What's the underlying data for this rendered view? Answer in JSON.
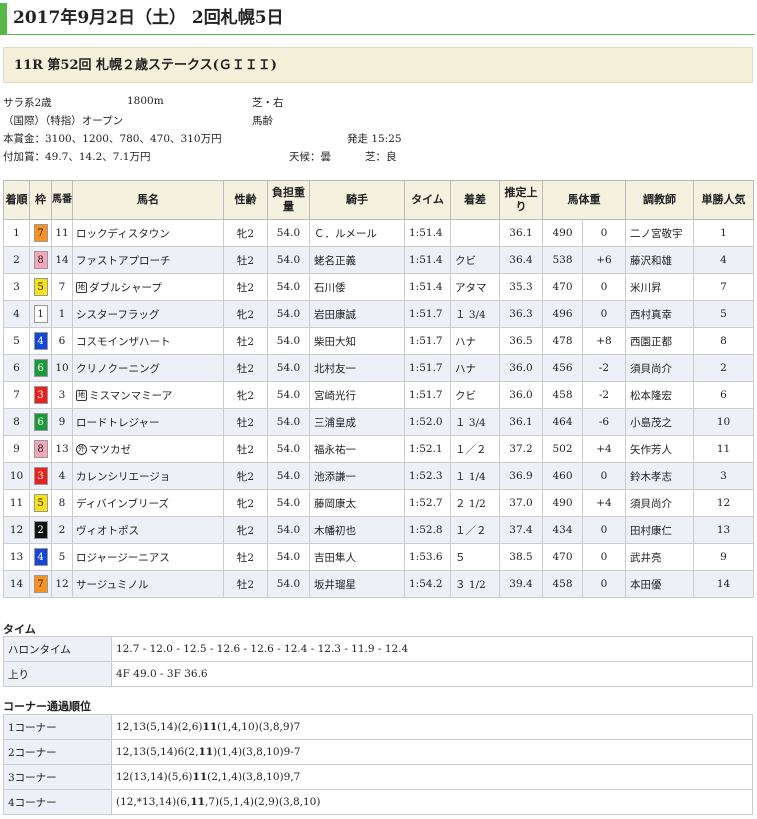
{
  "header": {
    "title": "2017年9月2日（土） 2回札幌5日"
  },
  "race": {
    "title": "11R 第52回 札幌２歳ステークス(ＧＩＩＩ)"
  },
  "conditions": {
    "class": "サラ系2歳",
    "distance": "1800m",
    "surface": "芝・右",
    "entry": "（国際）（特指）オープン",
    "weight_rule": "馬齢",
    "prize": "本賞金：3100、1200、780、470、310万円",
    "post_time": "発走 15:25",
    "bonus": "付加賞：49.7、14.2、7.1万円",
    "weather": "天候：曇",
    "going": "芝：良"
  },
  "colors": {
    "waku": {
      "1": "#ffffff",
      "2": "#111111",
      "3": "#e8221d",
      "4": "#1547d6",
      "5": "#f7e21a",
      "6": "#1c9a3a",
      "7": "#f79221",
      "8": "#f3a7b8"
    }
  },
  "table": {
    "headers": [
      "着順",
      "枠",
      "馬番",
      "馬名",
      "性齢",
      "負担重量",
      "騎手",
      "タイム",
      "着差",
      "推定上り",
      "馬体重",
      "調教師",
      "単勝人気"
    ],
    "rows": [
      {
        "rank": "1",
        "waku": "7",
        "num": "11",
        "tag": "",
        "name": "ロックディスタウン",
        "sex": "牝2",
        "wt": "54.0",
        "jockey": "Ｃ．ルメール",
        "time": "1:51.4",
        "margin": "",
        "last": "36.1",
        "bw": "490",
        "diff": "0",
        "trainer": "二ノ宮敬宇",
        "pop": "1"
      },
      {
        "rank": "2",
        "waku": "8",
        "num": "14",
        "tag": "",
        "name": "ファストアプローチ",
        "sex": "牡2",
        "wt": "54.0",
        "jockey": "蛯名正義",
        "time": "1:51.4",
        "margin": "クビ",
        "last": "36.4",
        "bw": "538",
        "diff": "+6",
        "trainer": "藤沢和雄",
        "pop": "4"
      },
      {
        "rank": "3",
        "waku": "5",
        "num": "7",
        "tag": "地",
        "name": "ダブルシャープ",
        "sex": "牡2",
        "wt": "54.0",
        "jockey": "石川倭",
        "time": "1:51.4",
        "margin": "アタマ",
        "last": "35.3",
        "bw": "470",
        "diff": "0",
        "trainer": "米川昇",
        "pop": "7"
      },
      {
        "rank": "4",
        "waku": "1",
        "num": "1",
        "tag": "",
        "name": "シスターフラッグ",
        "sex": "牝2",
        "wt": "54.0",
        "jockey": "岩田康誠",
        "time": "1:51.7",
        "margin": "１ 3/4",
        "last": "36.3",
        "bw": "496",
        "diff": "0",
        "trainer": "西村真幸",
        "pop": "5"
      },
      {
        "rank": "5",
        "waku": "4",
        "num": "6",
        "tag": "",
        "name": "コスモインザハート",
        "sex": "牡2",
        "wt": "54.0",
        "jockey": "柴田大知",
        "time": "1:51.7",
        "margin": "ハナ",
        "last": "36.5",
        "bw": "478",
        "diff": "+8",
        "trainer": "西園正都",
        "pop": "8"
      },
      {
        "rank": "6",
        "waku": "6",
        "num": "10",
        "tag": "",
        "name": "クリノクーニング",
        "sex": "牡2",
        "wt": "54.0",
        "jockey": "北村友一",
        "time": "1:51.7",
        "margin": "ハナ",
        "last": "36.0",
        "bw": "456",
        "diff": "-2",
        "trainer": "須貝尚介",
        "pop": "2"
      },
      {
        "rank": "7",
        "waku": "3",
        "num": "3",
        "tag": "地",
        "name": "ミスマンマミーア",
        "sex": "牝2",
        "wt": "54.0",
        "jockey": "宮崎光行",
        "time": "1:51.7",
        "margin": "クビ",
        "last": "36.0",
        "bw": "458",
        "diff": "-2",
        "trainer": "松本隆宏",
        "pop": "6"
      },
      {
        "rank": "8",
        "waku": "6",
        "num": "9",
        "tag": "",
        "name": "ロードトレジャー",
        "sex": "牡2",
        "wt": "54.0",
        "jockey": "三浦皇成",
        "time": "1:52.0",
        "margin": "１ 3/4",
        "last": "36.1",
        "bw": "464",
        "diff": "-6",
        "trainer": "小島茂之",
        "pop": "10"
      },
      {
        "rank": "9",
        "waku": "8",
        "num": "13",
        "tag": "外",
        "name": "マツカゼ",
        "sex": "牡2",
        "wt": "54.0",
        "jockey": "福永祐一",
        "time": "1:52.1",
        "margin": "１／２",
        "last": "37.2",
        "bw": "502",
        "diff": "+4",
        "trainer": "矢作芳人",
        "pop": "11"
      },
      {
        "rank": "10",
        "waku": "3",
        "num": "4",
        "tag": "",
        "name": "カレンシリエージョ",
        "sex": "牝2",
        "wt": "54.0",
        "jockey": "池添謙一",
        "time": "1:52.3",
        "margin": "１ 1/4",
        "last": "36.9",
        "bw": "460",
        "diff": "0",
        "trainer": "鈴木孝志",
        "pop": "3"
      },
      {
        "rank": "11",
        "waku": "5",
        "num": "8",
        "tag": "",
        "name": "ディバインブリーズ",
        "sex": "牝2",
        "wt": "54.0",
        "jockey": "藤岡康太",
        "time": "1:52.7",
        "margin": "２ 1/2",
        "last": "37.0",
        "bw": "490",
        "diff": "+4",
        "trainer": "須貝尚介",
        "pop": "12"
      },
      {
        "rank": "12",
        "waku": "2",
        "num": "2",
        "tag": "",
        "name": "ヴィオトポス",
        "sex": "牝2",
        "wt": "54.0",
        "jockey": "木幡初也",
        "time": "1:52.8",
        "margin": "１／２",
        "last": "37.4",
        "bw": "434",
        "diff": "0",
        "trainer": "田村康仁",
        "pop": "13"
      },
      {
        "rank": "13",
        "waku": "4",
        "num": "5",
        "tag": "",
        "name": "ロジャージーニアス",
        "sex": "牡2",
        "wt": "54.0",
        "jockey": "吉田隼人",
        "time": "1:53.6",
        "margin": "５",
        "last": "38.5",
        "bw": "470",
        "diff": "0",
        "trainer": "武井亮",
        "pop": "9"
      },
      {
        "rank": "14",
        "waku": "7",
        "num": "12",
        "tag": "",
        "name": "サージュミノル",
        "sex": "牡2",
        "wt": "54.0",
        "jockey": "坂井瑠星",
        "time": "1:54.2",
        "margin": "３ 1/2",
        "last": "39.4",
        "bw": "458",
        "diff": "0",
        "trainer": "本田優",
        "pop": "14"
      }
    ]
  },
  "times": {
    "title": "タイム",
    "rows": [
      {
        "label": "ハロンタイム",
        "value": "12.7 - 12.0 - 12.5 - 12.6 - 12.6 - 12.4 - 12.3 - 11.9 - 12.4"
      },
      {
        "label": "上り",
        "value": "4F 49.0 - 3F 36.6"
      }
    ]
  },
  "corners": {
    "title": "コーナー通過順位",
    "rows": [
      {
        "label": "1コーナー",
        "pre": "12,13(5,14)(2,6)",
        "bold": "11",
        "post": "(1,4,10)(3,8,9)7"
      },
      {
        "label": "2コーナー",
        "pre": "12,13(5,14)6(2,",
        "bold": "11",
        "post": ")(1,4)(3,8,10)9-7"
      },
      {
        "label": "3コーナー",
        "pre": "12(13,14)(5,6)",
        "bold": "11",
        "post": "(2,1,4)(3,8,10)9,7"
      },
      {
        "label": "4コーナー",
        "pre": "(12,*13,14)(6,",
        "bold": "11",
        "post": ",7)(5,1,4)(2,9)(3,8,10)"
      }
    ]
  }
}
